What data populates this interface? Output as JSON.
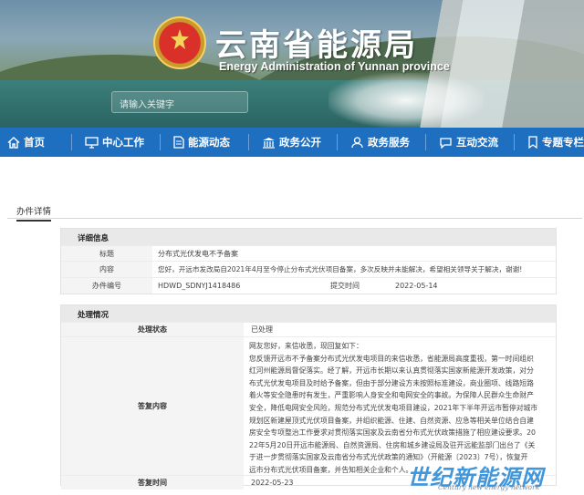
{
  "banner": {
    "title": "云南省能源局",
    "subtitle": "Energy Administration of Yunnan province",
    "search_placeholder": "请输入关键字"
  },
  "nav": {
    "items": [
      {
        "label": "首页",
        "icon": "home-icon"
      },
      {
        "label": "中心工作",
        "icon": "monitor-icon"
      },
      {
        "label": "能源动态",
        "icon": "document-icon"
      },
      {
        "label": "政务公开",
        "icon": "building-icon"
      },
      {
        "label": "政务服务",
        "icon": "people-icon"
      },
      {
        "label": "互动交流",
        "icon": "chat-icon"
      },
      {
        "label": "专题专栏",
        "icon": "bookmark-icon"
      }
    ]
  },
  "tab": {
    "label": "办件详情"
  },
  "detail": {
    "heading": "详细信息",
    "title_label": "标题",
    "title_value": "分布式光伏发电不予备案",
    "content_label": "内容",
    "content_value": "您好，开远市发改局自2021年4月至今停止分布式光伏项目备案，多次反映并未能解决，希望相关领导关于解决，谢谢!",
    "number_label": "办件编号",
    "number_value": "HDWD_SDNYJ1418486",
    "time_label": "提交时间",
    "time_value": "2022-05-14"
  },
  "process": {
    "heading": "处理情况",
    "status_label": "处理状态",
    "status_value": "已处理",
    "reply_label": "答复内容",
    "reply_lines": [
      "网友您好，来信收悉，现回复如下：",
      "    您反馈开远市不予备案分布式光伏发电项目的来信收悉，省能源局高度重视，第一时间组织",
      "红河州能源局督促落实。经了解，开远市长期以来认真贯彻落实国家新能源开发政策，对分",
      "布式光伏发电项目及时给予备案，但由于部分建设方未按照标准建设，商业圈项、线路短路",
      "着火等安全隐患时有发生，严重影响人身安全和电网安全的事故。为保障人民群众生命财产",
      "安全，降低电网安全风险，规范分布式光伏发电项目建设，2021年下半年开远市暂停对城市",
      "规划区新建屋顶式光伏项目备案，并组织能源、住建、自然资源、应急等相关单位结合自建",
      "房安全专项整治工作要求对贯彻落实国家及云南省分布式光伏政策措施了相应建设要求。20",
      "22年5月20日开远市能源局、自然资源局、住房和城乡建设局及驻开远能监部门出台了《关",
      "于进一步贯彻落实国家及云南省分布式光伏政策的通知》（开能源〔2023〕7号），恢复开",
      "远市分布式光伏项目备案，并告知相关企业和个人。"
    ],
    "reply_time_label": "答复时间",
    "reply_time_value": "2022-05-23"
  },
  "watermark": {
    "text": "世纪新能源网",
    "sub": "Century new energy network"
  }
}
